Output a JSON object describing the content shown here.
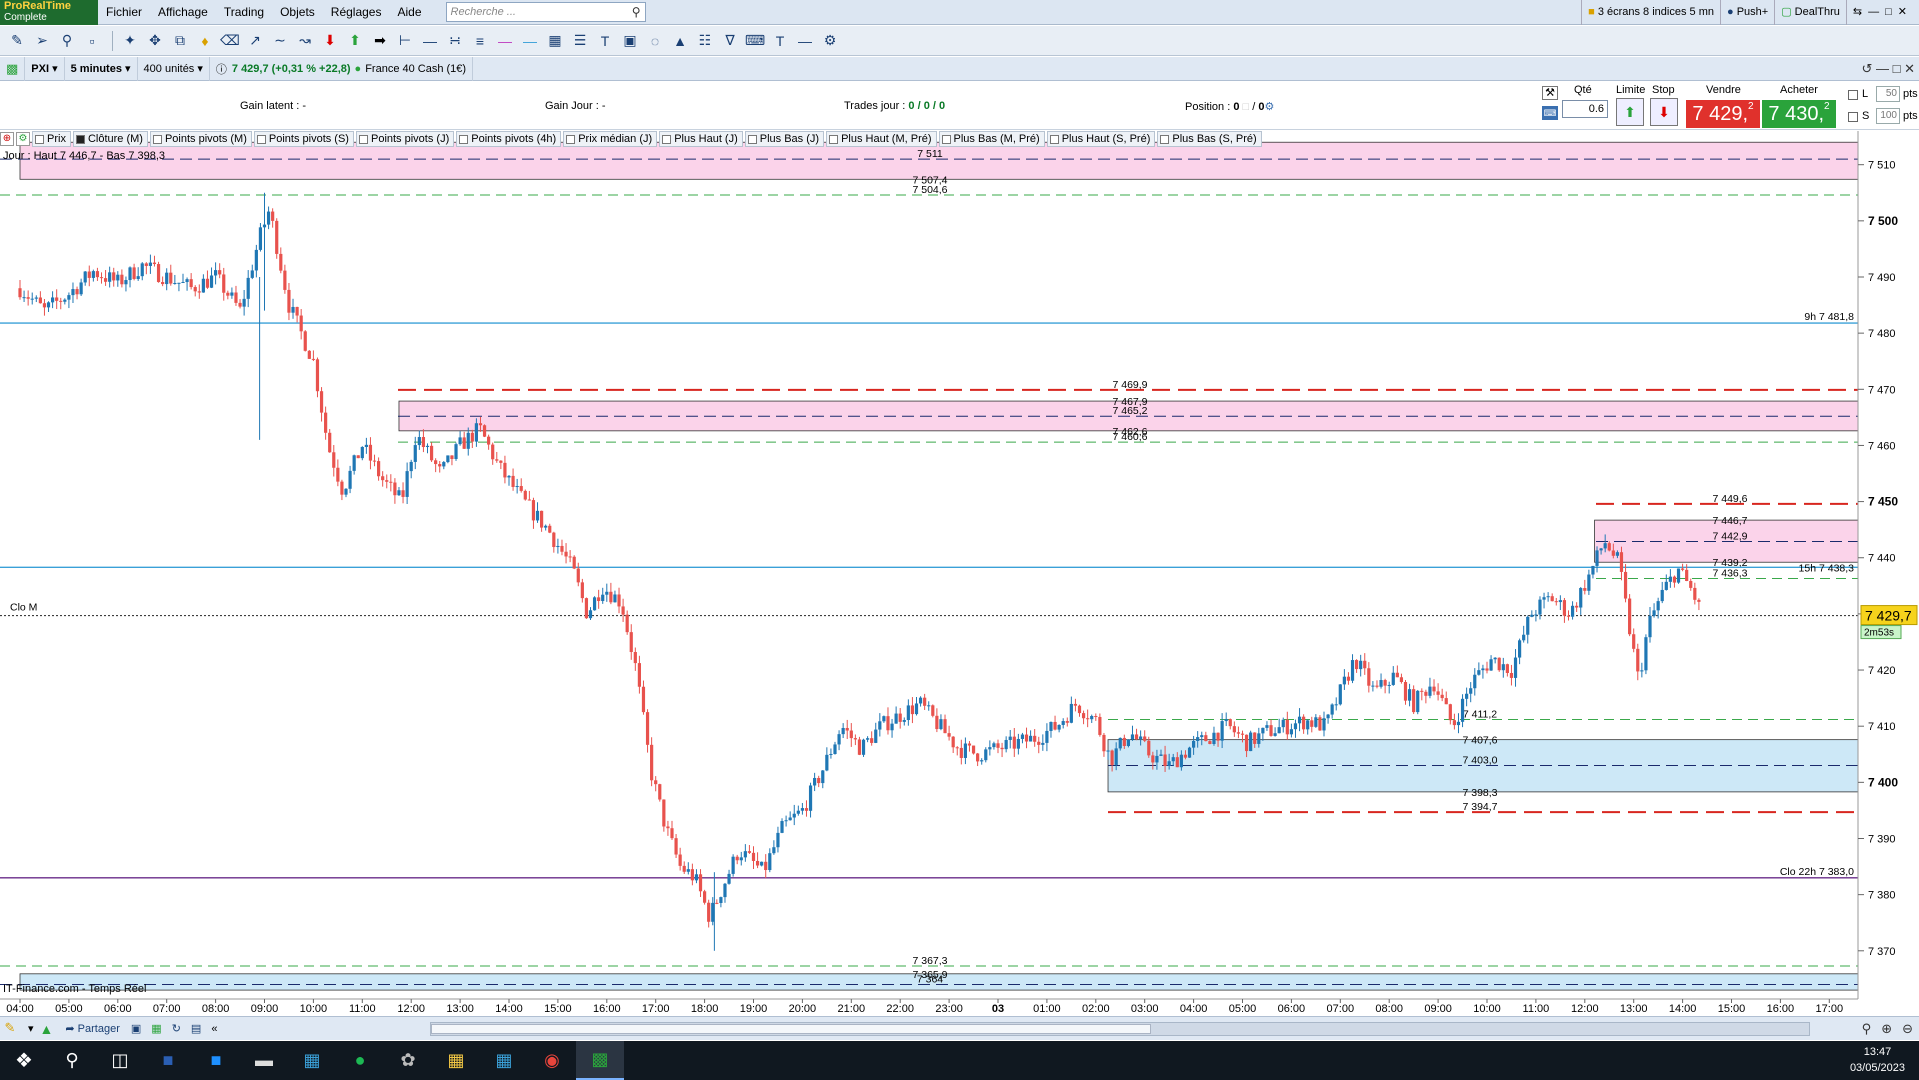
{
  "app": {
    "name": "ProRealTime",
    "edition": "Complete"
  },
  "menu": [
    "Fichier",
    "Affichage",
    "Trading",
    "Objets",
    "Réglages",
    "Aide"
  ],
  "search": {
    "placeholder": "Recherche ..."
  },
  "workspace": {
    "layout": "3 écrans 8 indices 5 mn",
    "push": "Push+",
    "broker": "DealThru"
  },
  "chart_header": {
    "symbol": "PXI",
    "timeframe": "5 minutes",
    "units": "400 unités",
    "quote": "7 429,7 (+0,31 % +22,8)",
    "instrument": "France 40 Cash (1€)"
  },
  "trading_info": {
    "gain_latent_label": "Gain latent :",
    "gain_latent_value": "-",
    "gain_jour_label": "Gain Jour :",
    "gain_jour_value": "-",
    "trades_jour_label": "Trades jour :",
    "trades_jour_value": "0 / 0 / 0",
    "position_label": "Position :",
    "position_value": "0",
    "position_value2": "0"
  },
  "order_panel": {
    "qty_label": "Qté",
    "qty_value": "0.6",
    "limit_label": "Limite",
    "stop_label": "Stop",
    "sell_label": "Vendre",
    "sell_price": "7 429,",
    "sell_sup": "2",
    "buy_label": "Acheter",
    "buy_price": "7 430,",
    "buy_sup": "2",
    "l_label": "L",
    "l_pts": "50",
    "s_label": "S",
    "s_pts": "100",
    "pts": "pts"
  },
  "indicators": [
    "Prix",
    "Clôture (M)",
    "Points pivots (M)",
    "Points pivots (S)",
    "Points pivots (J)",
    "Points pivots (4h)",
    "Prix médian (J)",
    "Plus Haut (J)",
    "Plus Bas (J)",
    "Plus Haut (M, Pré)",
    "Plus Bas (M, Pré)",
    "Plus Haut (S, Pré)",
    "Plus Bas (S, Pré)"
  ],
  "chart_texts": {
    "jour": "Jour : Haut 7 446,7 - Bas 7 398,3",
    "feed": "IT-Finance.com - Temps Réel",
    "clo_m": "Clo M",
    "line_9h": "9h 7 481,8",
    "line_15h": "15h 7 438,3",
    "line_clo22": "Clo 22h 7 383,0",
    "current_price": "7 429,7",
    "countdown": "2m53s"
  },
  "chart_data": {
    "type": "candlestick",
    "y_axis": {
      "min": 7363,
      "max": 7516,
      "ticks": [
        7370,
        7380,
        7390,
        7400,
        7410,
        7420,
        7430,
        7440,
        7450,
        7460,
        7470,
        7480,
        7490,
        7500,
        7510
      ],
      "bold_ticks": [
        7400,
        7450,
        7500
      ]
    },
    "x_axis": {
      "labels": [
        "04:00",
        "05:00",
        "06:00",
        "07:00",
        "08:00",
        "09:00",
        "10:00",
        "11:00",
        "12:00",
        "13:00",
        "14:00",
        "15:00",
        "16:00",
        "17:00",
        "18:00",
        "19:00",
        "20:00",
        "21:00",
        "22:00",
        "23:00",
        "03",
        "01:00",
        "02:00",
        "03:00",
        "04:00",
        "05:00",
        "06:00",
        "07:00",
        "08:00",
        "09:00",
        "10:00",
        "11:00",
        "12:00",
        "13:00",
        "14:00",
        "15:00",
        "16:00",
        "17:00"
      ]
    },
    "up_color": "#1f77b4",
    "down_color": "#e8524d",
    "levels": [
      {
        "value": 7511.0,
        "label": "7 511",
        "style": "dash-navy"
      },
      {
        "value": 7507.4,
        "label": "7 507,4",
        "style": "zone-edge"
      },
      {
        "value": 7504.6,
        "label": "7 504,6",
        "style": "dash-green"
      },
      {
        "value": 7469.9,
        "label": "7 469,9",
        "style": "dash-red"
      },
      {
        "value": 7467.9,
        "label": "7 467,9",
        "style": "zone-edge"
      },
      {
        "value": 7465.2,
        "label": "7 465,2",
        "style": "dash-navy"
      },
      {
        "value": 7462.6,
        "label": "7 462,6",
        "style": "zone-edge"
      },
      {
        "value": 7460.6,
        "label": "7 460,6",
        "style": "dash-green"
      },
      {
        "value": 7449.6,
        "label": "7 449,6",
        "style": "dash-red"
      },
      {
        "value": 7446.7,
        "label": "7 446,7",
        "style": "zone-edge"
      },
      {
        "value": 7442.9,
        "label": "7 442,9",
        "style": "dash-navy"
      },
      {
        "value": 7439.2,
        "label": "7 439,2",
        "style": "zone-edge"
      },
      {
        "value": 7436.3,
        "label": "7 436,3",
        "style": "dash-green"
      },
      {
        "value": 7411.2,
        "label": "7 411,2",
        "style": "dash-green"
      },
      {
        "value": 7407.6,
        "label": "7 407,6",
        "style": "zone-edge"
      },
      {
        "value": 7403.0,
        "label": "7 403,0",
        "style": "dash-navy"
      },
      {
        "value": 7398.3,
        "label": "7 398,3",
        "style": "zone-edge"
      },
      {
        "value": 7394.7,
        "label": "7 394,7",
        "style": "dash-red"
      },
      {
        "value": 7367.3,
        "label": "7 367,3",
        "style": "dash-green"
      },
      {
        "value": 7365.9,
        "label": "7 365,9",
        "style": "zone-edge"
      },
      {
        "value": 7364.0,
        "label": "7 364",
        "style": "dash-navy"
      }
    ],
    "zones": [
      {
        "top": 7514.0,
        "bottom": 7507.4,
        "color": "#fbd3ea",
        "start_hour": 0
      },
      {
        "top": 7467.9,
        "bottom": 7462.6,
        "color": "#fbd3ea",
        "start_hour": 7.75
      },
      {
        "top": 7446.7,
        "bottom": 7439.2,
        "color": "#fbd3ea",
        "start_hour": 32.2
      },
      {
        "top": 7407.6,
        "bottom": 7398.3,
        "color": "#cde8f7",
        "start_hour": 22.25
      },
      {
        "top": 7365.9,
        "bottom": 7363.0,
        "color": "#cde8f7",
        "start_hour": 0
      }
    ],
    "solid_lines": [
      {
        "value": 7481.8,
        "color": "#3aa0d8"
      },
      {
        "value": 7438.3,
        "color": "#3aa0d8"
      },
      {
        "value": 7383.0,
        "color": "#6a2c8a"
      }
    ],
    "close_m": 7429.7,
    "path": [
      [
        0,
        7488
      ],
      [
        0.5,
        7484
      ],
      [
        1,
        7487
      ],
      [
        1.5,
        7491
      ],
      [
        2,
        7489
      ],
      [
        2.5,
        7492
      ],
      [
        3,
        7490
      ],
      [
        3.5,
        7488
      ],
      [
        4,
        7490
      ],
      [
        4.5,
        7484
      ],
      [
        4.9,
        7497
      ],
      [
        5.1,
        7502
      ],
      [
        5.5,
        7485
      ],
      [
        6,
        7475
      ],
      [
        6.3,
        7460
      ],
      [
        6.6,
        7452
      ],
      [
        7,
        7460
      ],
      [
        7.4,
        7454
      ],
      [
        7.8,
        7450
      ],
      [
        8.1,
        7462
      ],
      [
        8.6,
        7455
      ],
      [
        9,
        7460
      ],
      [
        9.4,
        7463
      ],
      [
        9.8,
        7456
      ],
      [
        10.3,
        7450
      ],
      [
        10.8,
        7445
      ],
      [
        11.3,
        7438
      ],
      [
        11.6,
        7430
      ],
      [
        11.9,
        7435
      ],
      [
        12.3,
        7432
      ],
      [
        12.6,
        7420
      ],
      [
        12.9,
        7402
      ],
      [
        13.2,
        7392
      ],
      [
        13.5,
        7385
      ],
      [
        13.8,
        7383
      ],
      [
        14.1,
        7376
      ],
      [
        14.4,
        7382
      ],
      [
        14.7,
        7388
      ],
      [
        15.2,
        7384
      ],
      [
        15.6,
        7392
      ],
      [
        16,
        7395
      ],
      [
        16.4,
        7402
      ],
      [
        16.8,
        7410
      ],
      [
        17.2,
        7406
      ],
      [
        17.6,
        7410
      ],
      [
        18,
        7412
      ],
      [
        18.4,
        7414
      ],
      [
        18.8,
        7410
      ],
      [
        19.2,
        7406
      ],
      [
        19.6,
        7405
      ],
      [
        20,
        7406
      ],
      [
        20.4,
        7407
      ],
      [
        20.8,
        7408
      ],
      [
        21.2,
        7410
      ],
      [
        21.6,
        7414
      ],
      [
        22,
        7411
      ],
      [
        22.3,
        7404
      ],
      [
        22.7,
        7409
      ],
      [
        23.1,
        7405
      ],
      [
        23.5,
        7403
      ],
      [
        23.9,
        7406
      ],
      [
        24.3,
        7408
      ],
      [
        24.7,
        7410
      ],
      [
        25.1,
        7407
      ],
      [
        25.5,
        7409
      ],
      [
        25.9,
        7410
      ],
      [
        26.3,
        7411
      ],
      [
        26.7,
        7410
      ],
      [
        27,
        7416
      ],
      [
        27.3,
        7422
      ],
      [
        27.7,
        7416
      ],
      [
        28.1,
        7419
      ],
      [
        28.5,
        7414
      ],
      [
        28.9,
        7418
      ],
      [
        29.3,
        7410
      ],
      [
        29.7,
        7418
      ],
      [
        30.1,
        7422
      ],
      [
        30.5,
        7420
      ],
      [
        30.9,
        7430
      ],
      [
        31.3,
        7433
      ],
      [
        31.7,
        7430
      ],
      [
        32.1,
        7437
      ],
      [
        32.4,
        7443
      ],
      [
        32.7,
        7439
      ],
      [
        32.9,
        7428
      ],
      [
        33.1,
        7418
      ],
      [
        33.3,
        7428
      ],
      [
        33.6,
        7434
      ],
      [
        33.9,
        7438
      ],
      [
        34.2,
        7434
      ],
      [
        34.4,
        7429.7
      ]
    ]
  }
}
